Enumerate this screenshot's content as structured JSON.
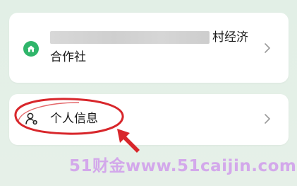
{
  "organization": {
    "name_suffix": "村经济",
    "name_line2": "合作社",
    "icon": "home-icon",
    "chevron_icon": "chevron-right-icon"
  },
  "personal_info": {
    "label": "个人信息",
    "icon": "person-settings-icon",
    "chevron_icon": "chevron-right-icon"
  },
  "annotation": {
    "color": "#d8262b",
    "ellipse": "highlight-ellipse",
    "arrow": "pointer-arrow-icon"
  },
  "watermark": {
    "text": "51财金www.51caijin.com",
    "color": "#ce96eb"
  },
  "colors": {
    "background": "#e3efe6",
    "card": "#ffffff",
    "accent_green": "#2fb56a"
  }
}
